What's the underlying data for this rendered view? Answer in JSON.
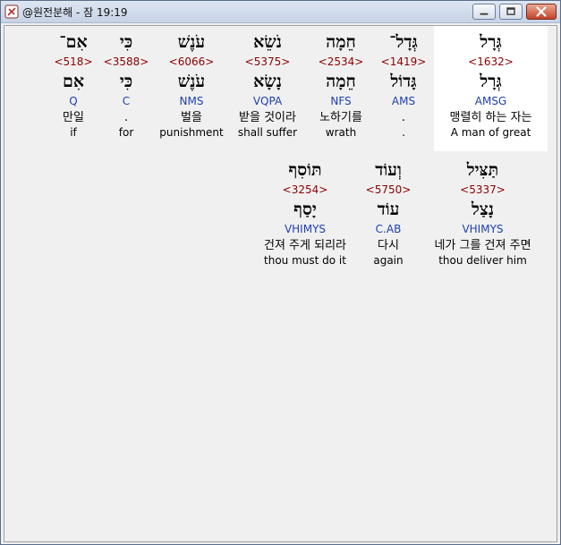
{
  "window": {
    "title": "@원전분해 - 잠 19:19"
  },
  "rows": [
    {
      "words": [
        {
          "hebrew": "גְּרָל",
          "strong": "<1632>",
          "lemma": "גְּרָל",
          "morph": "AMSG",
          "korean": "맹렬히 하는 자는",
          "english": "A man of great",
          "highlighted": true
        },
        {
          "hebrew": "גְּדָל־",
          "strong": "<1419>",
          "lemma": "גָּדוֹל",
          "morph": "AMS",
          "korean": ".",
          "english": ".",
          "highlighted": false
        },
        {
          "hebrew": "חֵמָה",
          "strong": "<2534>",
          "lemma": "חֵמָה",
          "morph": "NFS",
          "korean": "노하기를",
          "english": "wrath",
          "highlighted": false
        },
        {
          "hebrew": "נֹשֵׂא",
          "strong": "<5375>",
          "lemma": "נָשָׂא",
          "morph": "VQPA",
          "korean": "받을 것이라",
          "english": "shall suffer",
          "highlighted": false
        },
        {
          "hebrew": "עֹנֶשׁ",
          "strong": "<6066>",
          "lemma": "עֹנֶשׁ",
          "morph": "NMS",
          "korean": "벌을",
          "english": "punishment",
          "highlighted": false
        },
        {
          "hebrew": "כִּי",
          "strong": "<3588>",
          "lemma": "כִּי",
          "morph": "C",
          "korean": ".",
          "english": "for",
          "highlighted": false
        },
        {
          "hebrew": "אִם־",
          "strong": "<518>",
          "lemma": "אִם",
          "morph": "Q",
          "korean": "만일",
          "english": "if",
          "highlighted": false
        }
      ]
    },
    {
      "words": [
        {
          "hebrew": "תַּצִּיל",
          "strong": "<5337>",
          "lemma": "נָצַל",
          "morph": "VHIMYS",
          "korean": "네가 그를 건져 주면",
          "english": "thou deliver him",
          "highlighted": false
        },
        {
          "hebrew": "וְעוֹד",
          "strong": "<5750>",
          "lemma": "עוֹד",
          "morph": "C.AB",
          "korean": "다시",
          "english": "again",
          "highlighted": false
        },
        {
          "hebrew": "תּוֹסִף",
          "strong": "<3254>",
          "lemma": "יָסַף",
          "morph": "VHIMYS",
          "korean": "건져 주게 되리라",
          "english": "thou must do it",
          "highlighted": false
        }
      ]
    }
  ]
}
